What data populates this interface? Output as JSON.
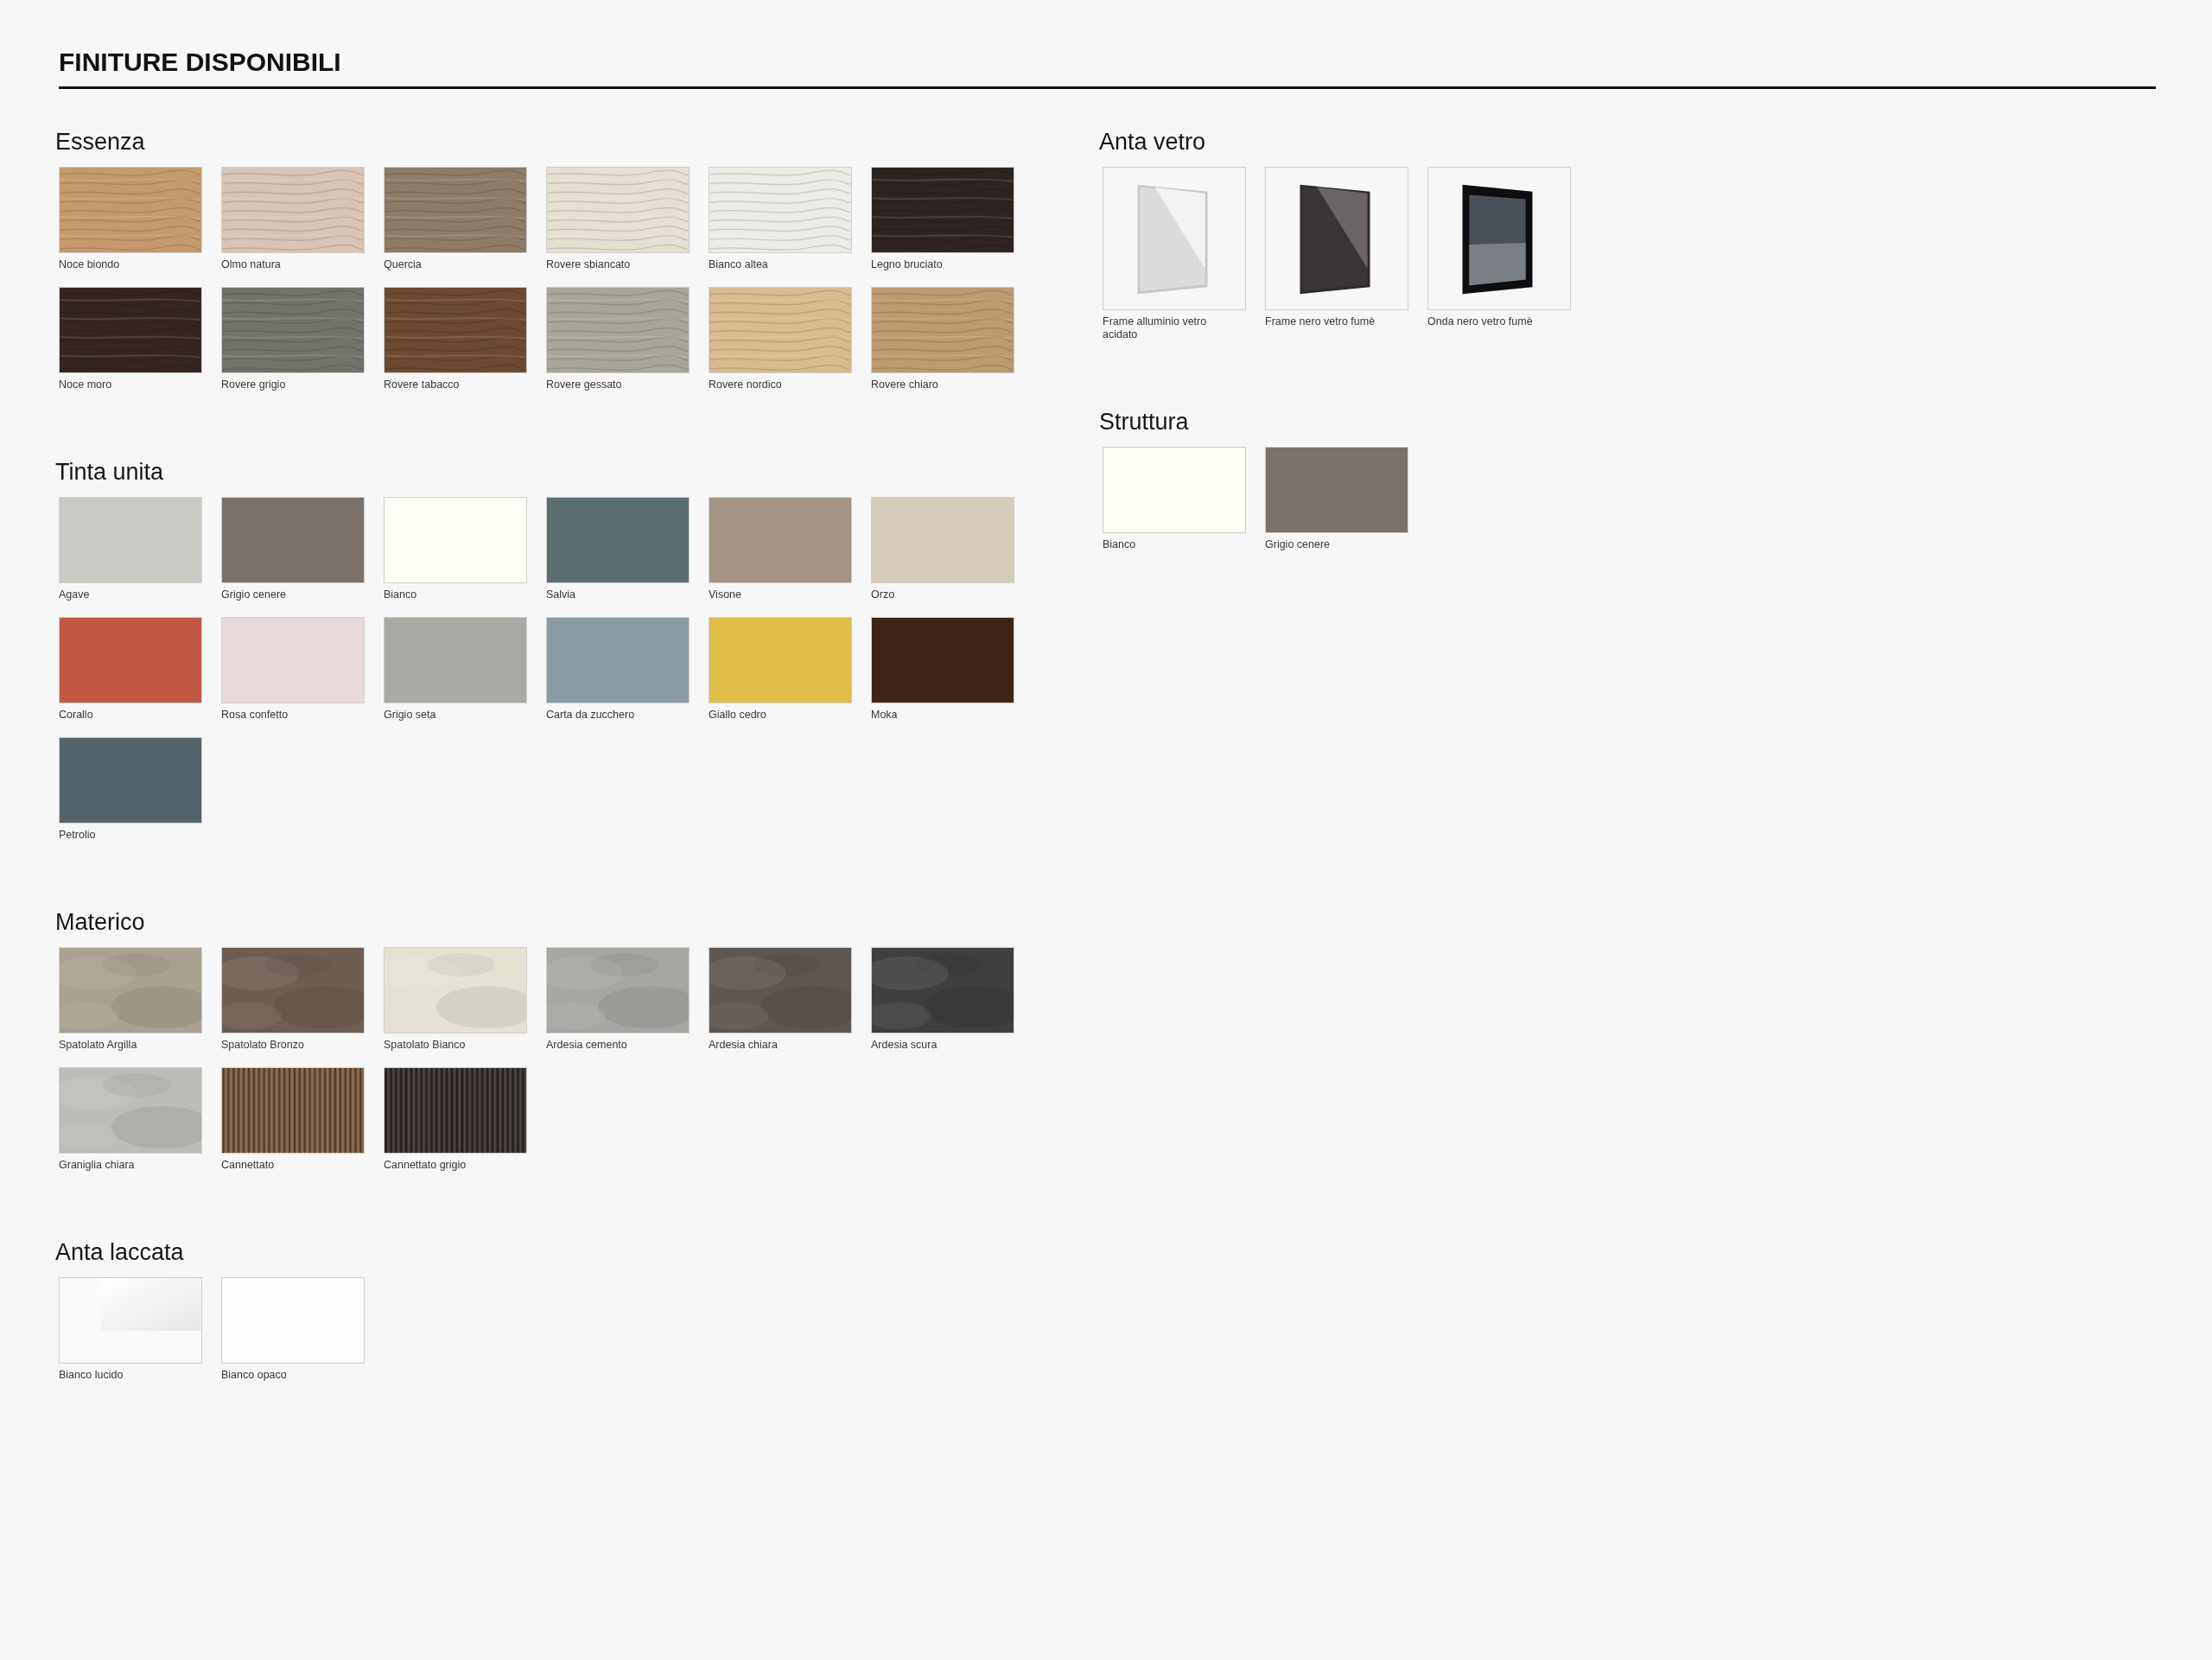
{
  "title": "FINITURE DISPONIBILI",
  "columns": [
    {
      "sections": [
        {
          "heading": "Essenza",
          "swatches": [
            {
              "label": "Noce biondo",
              "kind": "wood",
              "color": "#c49a6c"
            },
            {
              "label": "Olmo natura",
              "kind": "wood",
              "color": "#d8c4b5"
            },
            {
              "label": "Quercia",
              "kind": "wood",
              "color": "#8f7c66"
            },
            {
              "label": "Rovere sbiancato",
              "kind": "wood",
              "color": "#e6e0d3"
            },
            {
              "label": "Bianco altea",
              "kind": "wood",
              "color": "#ecebe6"
            },
            {
              "label": "Legno bruciato",
              "kind": "wood",
              "color": "#2e2522"
            },
            {
              "label": "Noce moro",
              "kind": "wood",
              "color": "#352522"
            },
            {
              "label": "Rovere grigio",
              "kind": "wood",
              "color": "#72716a"
            },
            {
              "label": "Rovere tabacco",
              "kind": "wood",
              "color": "#6d4a30"
            },
            {
              "label": "Rovere gessato",
              "kind": "wood",
              "color": "#aaa59b"
            },
            {
              "label": "Rovere nordico",
              "kind": "wood",
              "color": "#d9bb8f"
            },
            {
              "label": "Rovere chiaro",
              "kind": "wood",
              "color": "#bd9a6f"
            }
          ]
        },
        {
          "heading": "Tinta unita",
          "swatches": [
            {
              "label": "Agave",
              "kind": "solid",
              "color": "#cbcbc6"
            },
            {
              "label": "Grigio cenere",
              "kind": "solid",
              "color": "#7b716b"
            },
            {
              "label": "Bianco",
              "kind": "solid",
              "color": "#fefef6"
            },
            {
              "label": "Salvia",
              "kind": "solid",
              "color": "#5a6e70"
            },
            {
              "label": "Visone",
              "kind": "solid",
              "color": "#a39485"
            },
            {
              "label": "Orzo",
              "kind": "solid",
              "color": "#d5cbba"
            },
            {
              "label": "Corallo",
              "kind": "solid",
              "color": "#c25843"
            },
            {
              "label": "Rosa confetto",
              "kind": "solid",
              "color": "#e8dada"
            },
            {
              "label": "Grigio seta",
              "kind": "solid",
              "color": "#aaa9a4"
            },
            {
              "label": "Carta da zucchero",
              "kind": "solid",
              "color": "#8a9ba3"
            },
            {
              "label": "Giallo cedro",
              "kind": "solid",
              "color": "#dfbf48"
            },
            {
              "label": "Moka",
              "kind": "solid",
              "color": "#3e2319"
            },
            {
              "label": "Petrolio",
              "kind": "solid",
              "color": "#546369"
            }
          ]
        },
        {
          "heading": "Materico",
          "swatches": [
            {
              "label": "Spatolato Argilla",
              "kind": "stone",
              "color": "#a9a191"
            },
            {
              "label": "Spatolato Bronzo",
              "kind": "stone",
              "color": "#6e5d52"
            },
            {
              "label": "Spatolato Bianco",
              "kind": "stone",
              "color": "#e5e2d4"
            },
            {
              "label": "Ardesia cemento",
              "kind": "stone",
              "color": "#a8a6a3"
            },
            {
              "label": "Ardesia chiara",
              "kind": "stone",
              "color": "#5e5650"
            },
            {
              "label": "Ardesia scura",
              "kind": "stone",
              "color": "#3f3f3d"
            },
            {
              "label": "Graniglia chiara",
              "kind": "stone",
              "color": "#bebcb8"
            },
            {
              "label": "Cannettato",
              "kind": "ribbed",
              "color": "#7a5d40"
            },
            {
              "label": "Cannettato grigio",
              "kind": "ribbed",
              "color": "#38302c"
            }
          ]
        },
        {
          "heading": "Anta laccata",
          "swatches": [
            {
              "label": "Bianco lucido",
              "kind": "gloss",
              "color": "#fafafa"
            },
            {
              "label": "Bianco opaco",
              "kind": "solid",
              "color": "#fdfdfd"
            }
          ]
        }
      ]
    },
    {
      "sections": [
        {
          "heading": "Anta vetro",
          "swatches": [
            {
              "label": "Frame alluminio vetro acidato",
              "kind": "frosted"
            },
            {
              "label": "Frame nero vetro fumè",
              "kind": "smoked"
            },
            {
              "label": "Onda nero vetro fumè",
              "kind": "framed"
            }
          ]
        },
        {
          "heading": "Struttura",
          "swatches": [
            {
              "label": "Bianco",
              "kind": "solid",
              "color": "#fefef6"
            },
            {
              "label": "Grigio cenere",
              "kind": "solid",
              "color": "#7b716b"
            }
          ]
        }
      ]
    }
  ]
}
